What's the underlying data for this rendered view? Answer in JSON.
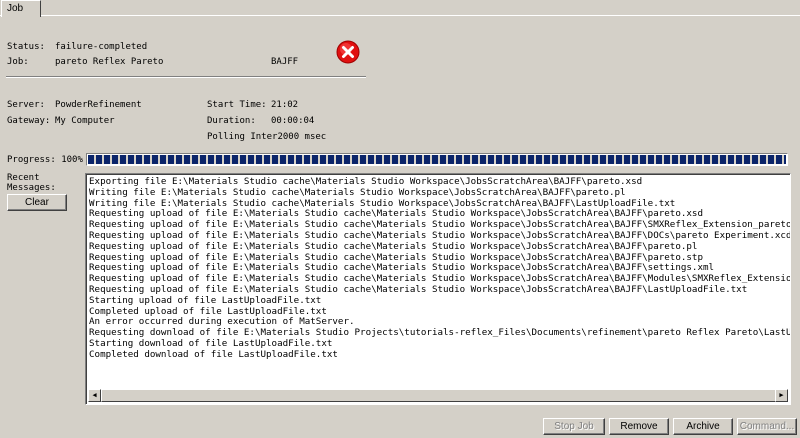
{
  "tab": {
    "label": "Job"
  },
  "status": {
    "label": "Status:",
    "value": "failure-completed"
  },
  "job": {
    "label": "Job:",
    "name": "pareto Reflex Pareto",
    "id": "BAJFF"
  },
  "status_icon": "error-icon",
  "server": {
    "label": "Server:",
    "value": "PowderRefinement"
  },
  "gateway": {
    "label": "Gateway:",
    "value": "My Computer"
  },
  "start_time": {
    "label": "Start Time:",
    "value": "21:02"
  },
  "duration": {
    "label": "Duration:",
    "value": "00:00:04"
  },
  "polling": {
    "label": "Polling Inter",
    "value": "2000 msec"
  },
  "progress": {
    "label": "Progress:",
    "value_text": "100%",
    "fraction": 1.0
  },
  "messages": {
    "label_line1": "Recent",
    "label_line2": "Messages:",
    "clear_label": "Clear",
    "lines": [
      "Exporting file E:\\Materials Studio cache\\Materials Studio Workspace\\JobsScratchArea\\BAJFF\\pareto.xsd",
      "Writing file E:\\Materials Studio cache\\Materials Studio Workspace\\JobsScratchArea\\BAJFF\\pareto.pl",
      "Writing file E:\\Materials Studio cache\\Materials Studio Workspace\\JobsScratchArea\\BAJFF\\LastUploadFile.txt",
      "Requesting upload of file E:\\Materials Studio cache\\Materials Studio Workspace\\JobsScratchArea\\BAJFF\\pareto.xsd",
      "Requesting upload of file E:\\Materials Studio cache\\Materials Studio Workspace\\JobsScratchArea\\BAJFF\\SMXReflex_Extension_pareto.xms",
      "Requesting upload of file E:\\Materials Studio cache\\Materials Studio Workspace\\JobsScratchArea\\BAJFF\\DOCs\\pareto Experiment.xcd",
      "Requesting upload of file E:\\Materials Studio cache\\Materials Studio Workspace\\JobsScratchArea\\BAJFF\\pareto.pl",
      "Requesting upload of file E:\\Materials Studio cache\\Materials Studio Workspace\\JobsScratchArea\\BAJFF\\pareto.stp",
      "Requesting upload of file E:\\Materials Studio cache\\Materials Studio Workspace\\JobsScratchArea\\BAJFF\\settings.xml",
      "Requesting upload of file E:\\Materials Studio cache\\Materials Studio Workspace\\JobsScratchArea\\BAJFF\\Modules\\SMXReflex_Extension.xml",
      "Requesting upload of file E:\\Materials Studio cache\\Materials Studio Workspace\\JobsScratchArea\\BAJFF\\LastUploadFile.txt",
      "Starting upload of file LastUploadFile.txt",
      "Completed upload of file LastUploadFile.txt",
      "An error occurred during execution of MatServer.",
      "Requesting download of file E:\\Materials Studio Projects\\tutorials-reflex_Files\\Documents\\refinement\\pareto Reflex Pareto\\LastUploadFile.tx",
      "Starting download of file LastUploadFile.txt",
      "Completed download of file LastUploadFile.txt"
    ]
  },
  "buttons": {
    "stop_job": "Stop Job",
    "remove": "Remove",
    "archive": "Archive",
    "command": "Command..."
  }
}
